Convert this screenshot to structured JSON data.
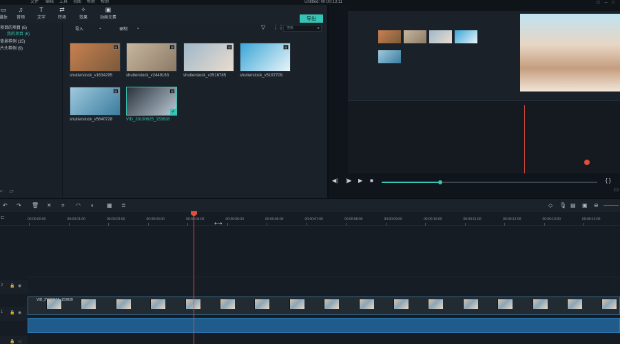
{
  "menubar": {
    "items": [
      "文件",
      "编辑",
      "工具",
      "视图",
      "帮助",
      "帮助"
    ],
    "title": "Untitled:  00:00:13:11"
  },
  "media_tabs": [
    {
      "label": "媒体",
      "icon": "folder-icon"
    },
    {
      "label": "音频",
      "icon": "music-note-icon"
    },
    {
      "label": "文字",
      "icon": "text-icon"
    },
    {
      "label": "转场",
      "icon": "transition-icon"
    },
    {
      "label": "效果",
      "icon": "effects-icon"
    },
    {
      "label": "动画元素",
      "icon": "elements-icon"
    }
  ],
  "export_label": "导出",
  "sidebar": {
    "items": [
      {
        "label": "项目的项目 (6)",
        "sub": false
      },
      {
        "label": "我的项目 (6)",
        "sub": true
      },
      {
        "label": "背景样例 (15)",
        "sub": false
      },
      {
        "label": "片头样例 (9)",
        "sub": false
      }
    ]
  },
  "media_toolbar": {
    "import_label": "导入",
    "record_label": "录制",
    "search_placeholder": "搜索"
  },
  "media_items": [
    {
      "name": "shutterstock_v1634295",
      "selected": false,
      "colors": [
        "#c9814f",
        "#7a5a3c"
      ]
    },
    {
      "name": "shutterstock_v2449163",
      "selected": false,
      "colors": [
        "#c7b79f",
        "#8c7a66"
      ]
    },
    {
      "name": "shutterstock_v3516785",
      "selected": false,
      "colors": [
        "#9fb8c8",
        "#e9dcd0"
      ]
    },
    {
      "name": "shutterstock_v5197709",
      "selected": false,
      "colors": [
        "#3aa6d8",
        "#e9f4f8"
      ]
    },
    {
      "name": "shutterstock_v5640728",
      "selected": false,
      "colors": [
        "#9fc9de",
        "#3b7d9e"
      ]
    },
    {
      "name": "VID_20190625_153628",
      "selected": true,
      "colors": [
        "#2a333c",
        "#b9c8d4"
      ]
    }
  ],
  "preview": {
    "progress": 0.27
  },
  "timeline": {
    "ticks": [
      "00:00:00:00",
      "00:00:01:00",
      "00:00:02:00",
      "00:00:03:00",
      "00:00:04:00",
      "00:00:05:00",
      "00:00:06:00",
      "00:00:07:00",
      "00:00:08:00",
      "00:00:09:00",
      "00:00:10:00",
      "00:00:11:00",
      "00:00:12:00",
      "00:00:13:00",
      "00:00:14:00"
    ],
    "track_labels": [
      "2",
      "1"
    ],
    "clip_name": "VID_20190625_153628"
  },
  "colors": {
    "accent": "#36c5b4",
    "playhead": "#e04e3e",
    "audio": "#1f5c8c"
  }
}
